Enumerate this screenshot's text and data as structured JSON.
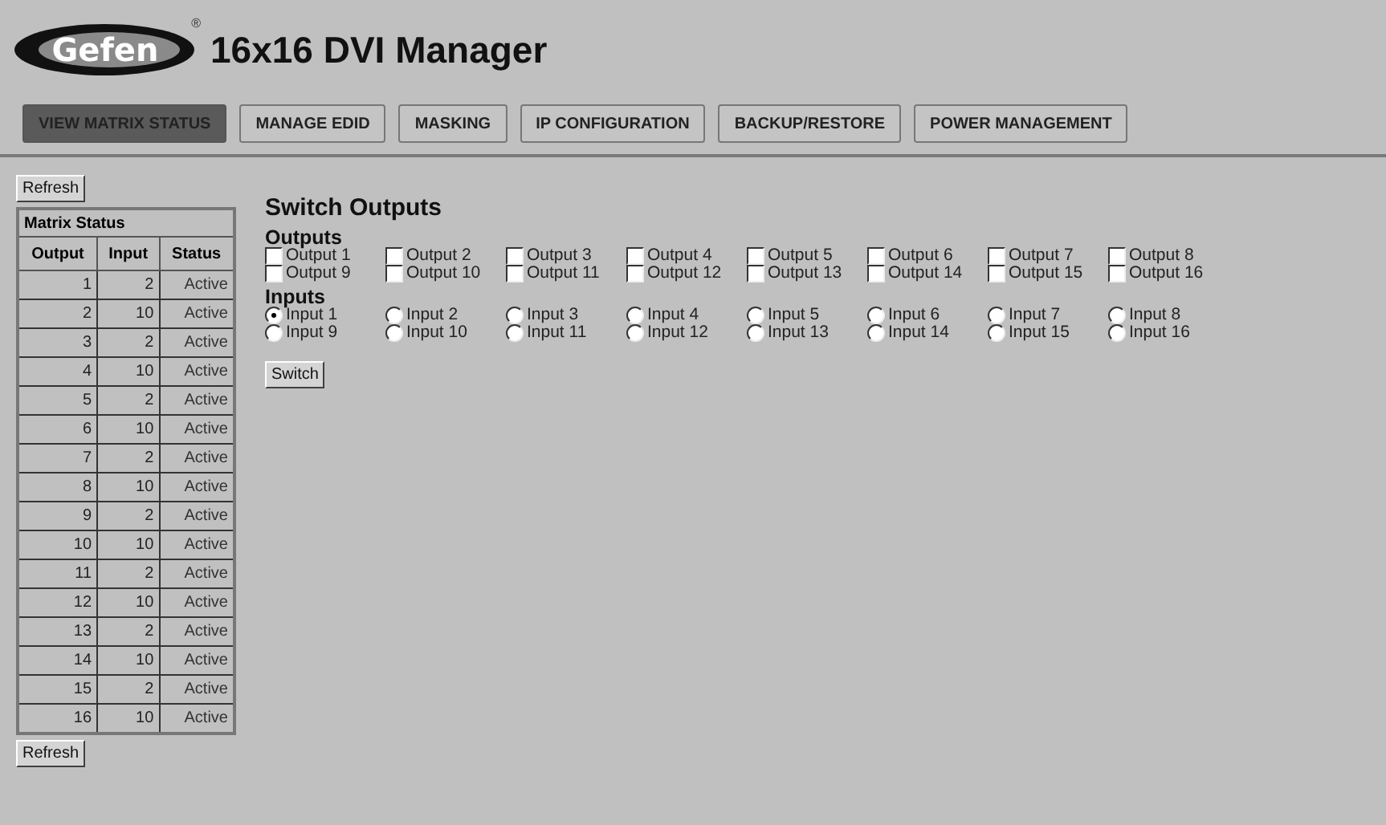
{
  "header": {
    "logo": "Gefen",
    "registered": "®",
    "title": "16x16 DVI Manager"
  },
  "tabs": [
    {
      "label": "VIEW MATRIX STATUS",
      "selected": true
    },
    {
      "label": "MANAGE EDID",
      "selected": false
    },
    {
      "label": "MASKING",
      "selected": false
    },
    {
      "label": "IP CONFIGURATION",
      "selected": false
    },
    {
      "label": "BACKUP/RESTORE",
      "selected": false
    },
    {
      "label": "POWER MANAGEMENT",
      "selected": false
    }
  ],
  "matrix": {
    "refresh_top": "Refresh",
    "title": "Matrix Status",
    "columns": [
      "Output",
      "Input",
      "Status"
    ],
    "rows": [
      [
        "1",
        "2",
        "Active"
      ],
      [
        "2",
        "10",
        "Active"
      ],
      [
        "3",
        "2",
        "Active"
      ],
      [
        "4",
        "10",
        "Active"
      ],
      [
        "5",
        "2",
        "Active"
      ],
      [
        "6",
        "10",
        "Active"
      ],
      [
        "7",
        "2",
        "Active"
      ],
      [
        "8",
        "10",
        "Active"
      ],
      [
        "9",
        "2",
        "Active"
      ],
      [
        "10",
        "10",
        "Active"
      ],
      [
        "11",
        "2",
        "Active"
      ],
      [
        "12",
        "10",
        "Active"
      ],
      [
        "13",
        "2",
        "Active"
      ],
      [
        "14",
        "10",
        "Active"
      ],
      [
        "15",
        "2",
        "Active"
      ],
      [
        "16",
        "10",
        "Active"
      ]
    ],
    "refresh_bottom": "Refresh"
  },
  "switch": {
    "title": "Switch Outputs",
    "outputs_label": "Outputs",
    "outputs": [
      {
        "label": "Output 1",
        "checked": false
      },
      {
        "label": "Output 2",
        "checked": false
      },
      {
        "label": "Output 3",
        "checked": false
      },
      {
        "label": "Output 4",
        "checked": false
      },
      {
        "label": "Output 5",
        "checked": false
      },
      {
        "label": "Output 6",
        "checked": false
      },
      {
        "label": "Output 7",
        "checked": false
      },
      {
        "label": "Output 8",
        "checked": false
      },
      {
        "label": "Output 9",
        "checked": false
      },
      {
        "label": "Output 10",
        "checked": false
      },
      {
        "label": "Output 11",
        "checked": false
      },
      {
        "label": "Output 12",
        "checked": false
      },
      {
        "label": "Output 13",
        "checked": false
      },
      {
        "label": "Output 14",
        "checked": false
      },
      {
        "label": "Output 15",
        "checked": false
      },
      {
        "label": "Output 16",
        "checked": false
      }
    ],
    "inputs_label": "Inputs",
    "inputs": [
      {
        "label": "Input 1",
        "selected": true
      },
      {
        "label": "Input 2",
        "selected": false
      },
      {
        "label": "Input 3",
        "selected": false
      },
      {
        "label": "Input 4",
        "selected": false
      },
      {
        "label": "Input 5",
        "selected": false
      },
      {
        "label": "Input 6",
        "selected": false
      },
      {
        "label": "Input 7",
        "selected": false
      },
      {
        "label": "Input 8",
        "selected": false
      },
      {
        "label": "Input 9",
        "selected": false
      },
      {
        "label": "Input 10",
        "selected": false
      },
      {
        "label": "Input 11",
        "selected": false
      },
      {
        "label": "Input 12",
        "selected": false
      },
      {
        "label": "Input 13",
        "selected": false
      },
      {
        "label": "Input 14",
        "selected": false
      },
      {
        "label": "Input 15",
        "selected": false
      },
      {
        "label": "Input 16",
        "selected": false
      }
    ],
    "button": "Switch"
  }
}
